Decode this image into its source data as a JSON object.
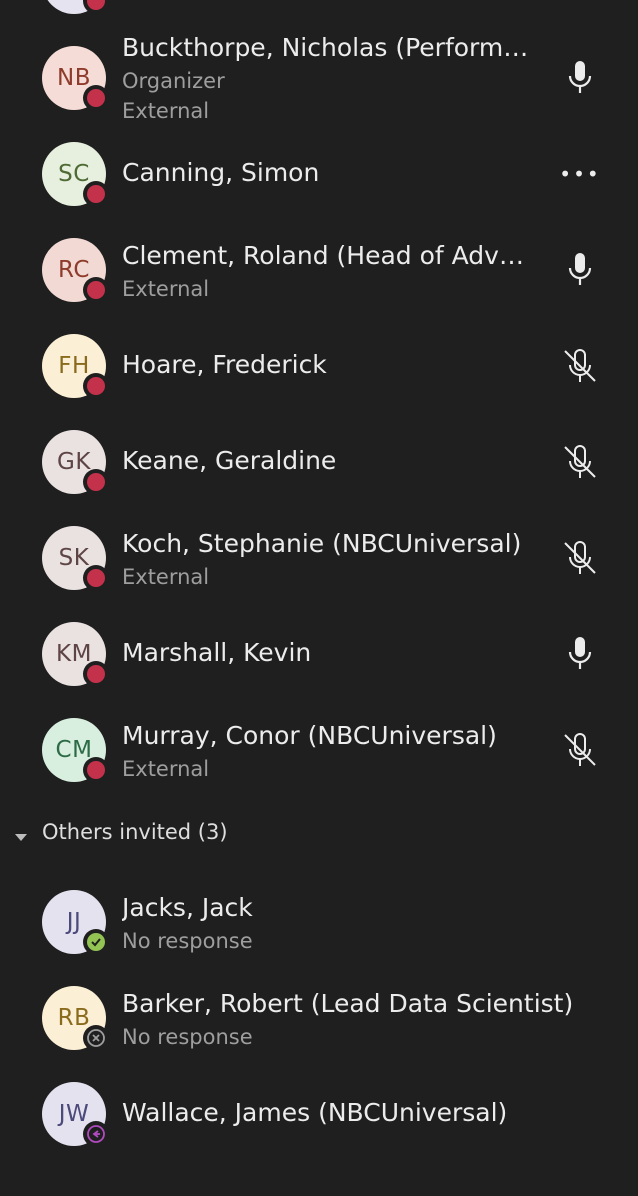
{
  "participants": [
    {
      "initials": "NB",
      "name": "Buckthorpe, Nicholas (Performa...",
      "role": "Organizer",
      "sub": "External",
      "mic": "mic-icon",
      "avatar_bg": "#f5dcd6",
      "avatar_fg": "#8e3b2b"
    },
    {
      "initials": "SC",
      "name": "Canning, Simon",
      "sub": "",
      "mic": "more-icon",
      "more_label": "•••",
      "avatar_bg": "#e7efde",
      "avatar_fg": "#4e6b35"
    },
    {
      "initials": "RC",
      "name": "Clement, Roland (Head of Adva...",
      "sub": "External",
      "mic": "mic-icon",
      "avatar_bg": "#f2d9d4",
      "avatar_fg": "#8e3b2b"
    },
    {
      "initials": "FH",
      "name": "Hoare, Frederick",
      "sub": "",
      "mic": "mic-off-icon",
      "avatar_bg": "#fbefd5",
      "avatar_fg": "#8a6a1c"
    },
    {
      "initials": "GK",
      "name": "Keane, Geraldine",
      "sub": "",
      "mic": "mic-off-icon",
      "avatar_bg": "#eae1e1",
      "avatar_fg": "#5e4444"
    },
    {
      "initials": "SK",
      "name": "Koch, Stephanie (NBCUniversal)",
      "sub": "External",
      "mic": "mic-off-icon",
      "avatar_bg": "#eae1e1",
      "avatar_fg": "#5e4444"
    },
    {
      "initials": "KM",
      "name": "Marshall, Kevin",
      "sub": "",
      "mic": "mic-icon",
      "avatar_bg": "#eae1e1",
      "avatar_fg": "#5e4444"
    },
    {
      "initials": "CM",
      "name": "Murray, Conor (NBCUniversal)",
      "sub": "External",
      "mic": "mic-off-icon",
      "avatar_bg": "#d8efe0",
      "avatar_fg": "#2d6b46"
    }
  ],
  "others_section": {
    "label": "Others invited (3)",
    "icon": "caret-down-icon"
  },
  "invited": [
    {
      "initials": "JJ",
      "name": "Jacks, Jack",
      "sub": "No response",
      "status": "available",
      "avatar_bg": "#e4e2ef",
      "avatar_fg": "#4b4a7a"
    },
    {
      "initials": "RB",
      "name": "Barker, Robert (Lead Data Scientist)",
      "sub": "No response",
      "status": "offline",
      "avatar_bg": "#fbefd5",
      "avatar_fg": "#8a6a1c"
    },
    {
      "initials": "JW",
      "name": "Wallace, James (NBCUniversal)",
      "sub": "",
      "status": "out-of-office",
      "avatar_bg": "#e4e2ef",
      "avatar_fg": "#4b4a7a"
    }
  ],
  "colors": {
    "background": "#1f1f1f",
    "busy": "#c4314b",
    "available": "#92c353",
    "ooo": "#b24ac0",
    "secondary_text": "#9e9e9e"
  }
}
